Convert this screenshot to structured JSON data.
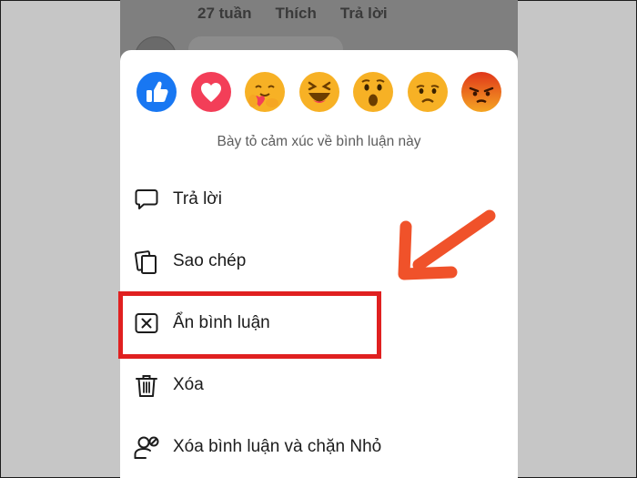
{
  "comment": {
    "time": "27 tuần",
    "like": "Thích",
    "reply": "Trả lời"
  },
  "reactions": [
    {
      "name": "like",
      "color": "#1877f2"
    },
    {
      "name": "love",
      "color": "#f33e58"
    },
    {
      "name": "care",
      "color": "#f7b125"
    },
    {
      "name": "haha",
      "color": "#f7b125"
    },
    {
      "name": "wow",
      "color": "#f7b125"
    },
    {
      "name": "sad",
      "color": "#f7b125"
    },
    {
      "name": "angry",
      "color": "#e9710f"
    }
  ],
  "prompt": "Bày tỏ cảm xúc về bình luận này",
  "menu": [
    {
      "label": "Trả lời",
      "icon": "speech-bubble-icon"
    },
    {
      "label": "Sao chép",
      "icon": "copy-icon"
    },
    {
      "label": "Ẩn bình luận",
      "icon": "hide-box-icon"
    },
    {
      "label": "Xóa",
      "icon": "trash-icon"
    },
    {
      "label": "Xóa bình luận và chặn Nhỏ",
      "icon": "block-user-icon"
    }
  ],
  "colors": {
    "highlight": "#e02020",
    "arrow": "#f0522a"
  }
}
